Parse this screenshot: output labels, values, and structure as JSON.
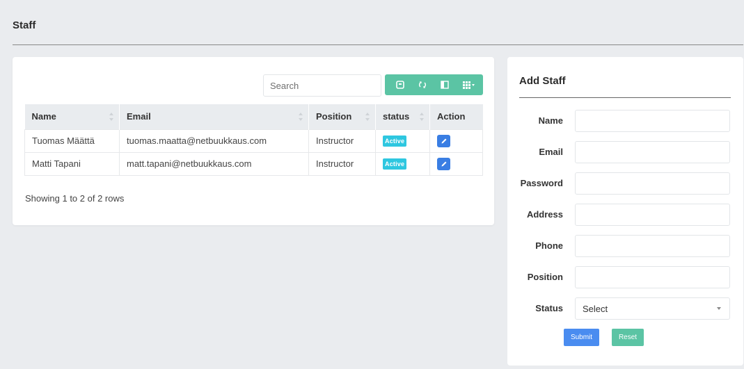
{
  "page": {
    "title": "Staff"
  },
  "table_panel": {
    "search": {
      "placeholder": "Search",
      "value": ""
    },
    "toolbar": {
      "buttons": [
        "toggle-icon",
        "refresh-icon",
        "columns-icon",
        "grid-icon"
      ]
    },
    "columns": [
      "Name",
      "Email",
      "Position",
      "status",
      "Action"
    ],
    "rows": [
      {
        "name": "Tuomas Määttä",
        "email": "tuomas.maatta@netbuukkaus.com",
        "position": "Instructor",
        "status": "Active"
      },
      {
        "name": "Matti Tapani",
        "email": "matt.tapani@netbuukkaus.com",
        "position": "Instructor",
        "status": "Active"
      }
    ],
    "pagination_info": "Showing 1 to 2 of 2 rows"
  },
  "form": {
    "title": "Add Staff",
    "fields": {
      "name": {
        "label": "Name",
        "value": ""
      },
      "email": {
        "label": "Email",
        "value": ""
      },
      "password": {
        "label": "Password",
        "value": ""
      },
      "address": {
        "label": "Address",
        "value": ""
      },
      "phone": {
        "label": "Phone",
        "value": ""
      },
      "position": {
        "label": "Position",
        "value": ""
      },
      "status": {
        "label": "Status",
        "value": "Select"
      }
    },
    "submit_label": "Submit",
    "reset_label": "Reset"
  },
  "colors": {
    "toolbar": "#5bc4a4",
    "active_badge": "#2ec7e0",
    "edit_button": "#3a7ee3",
    "submit_button": "#4a8cf0",
    "reset_button": "#5bc4a4"
  }
}
